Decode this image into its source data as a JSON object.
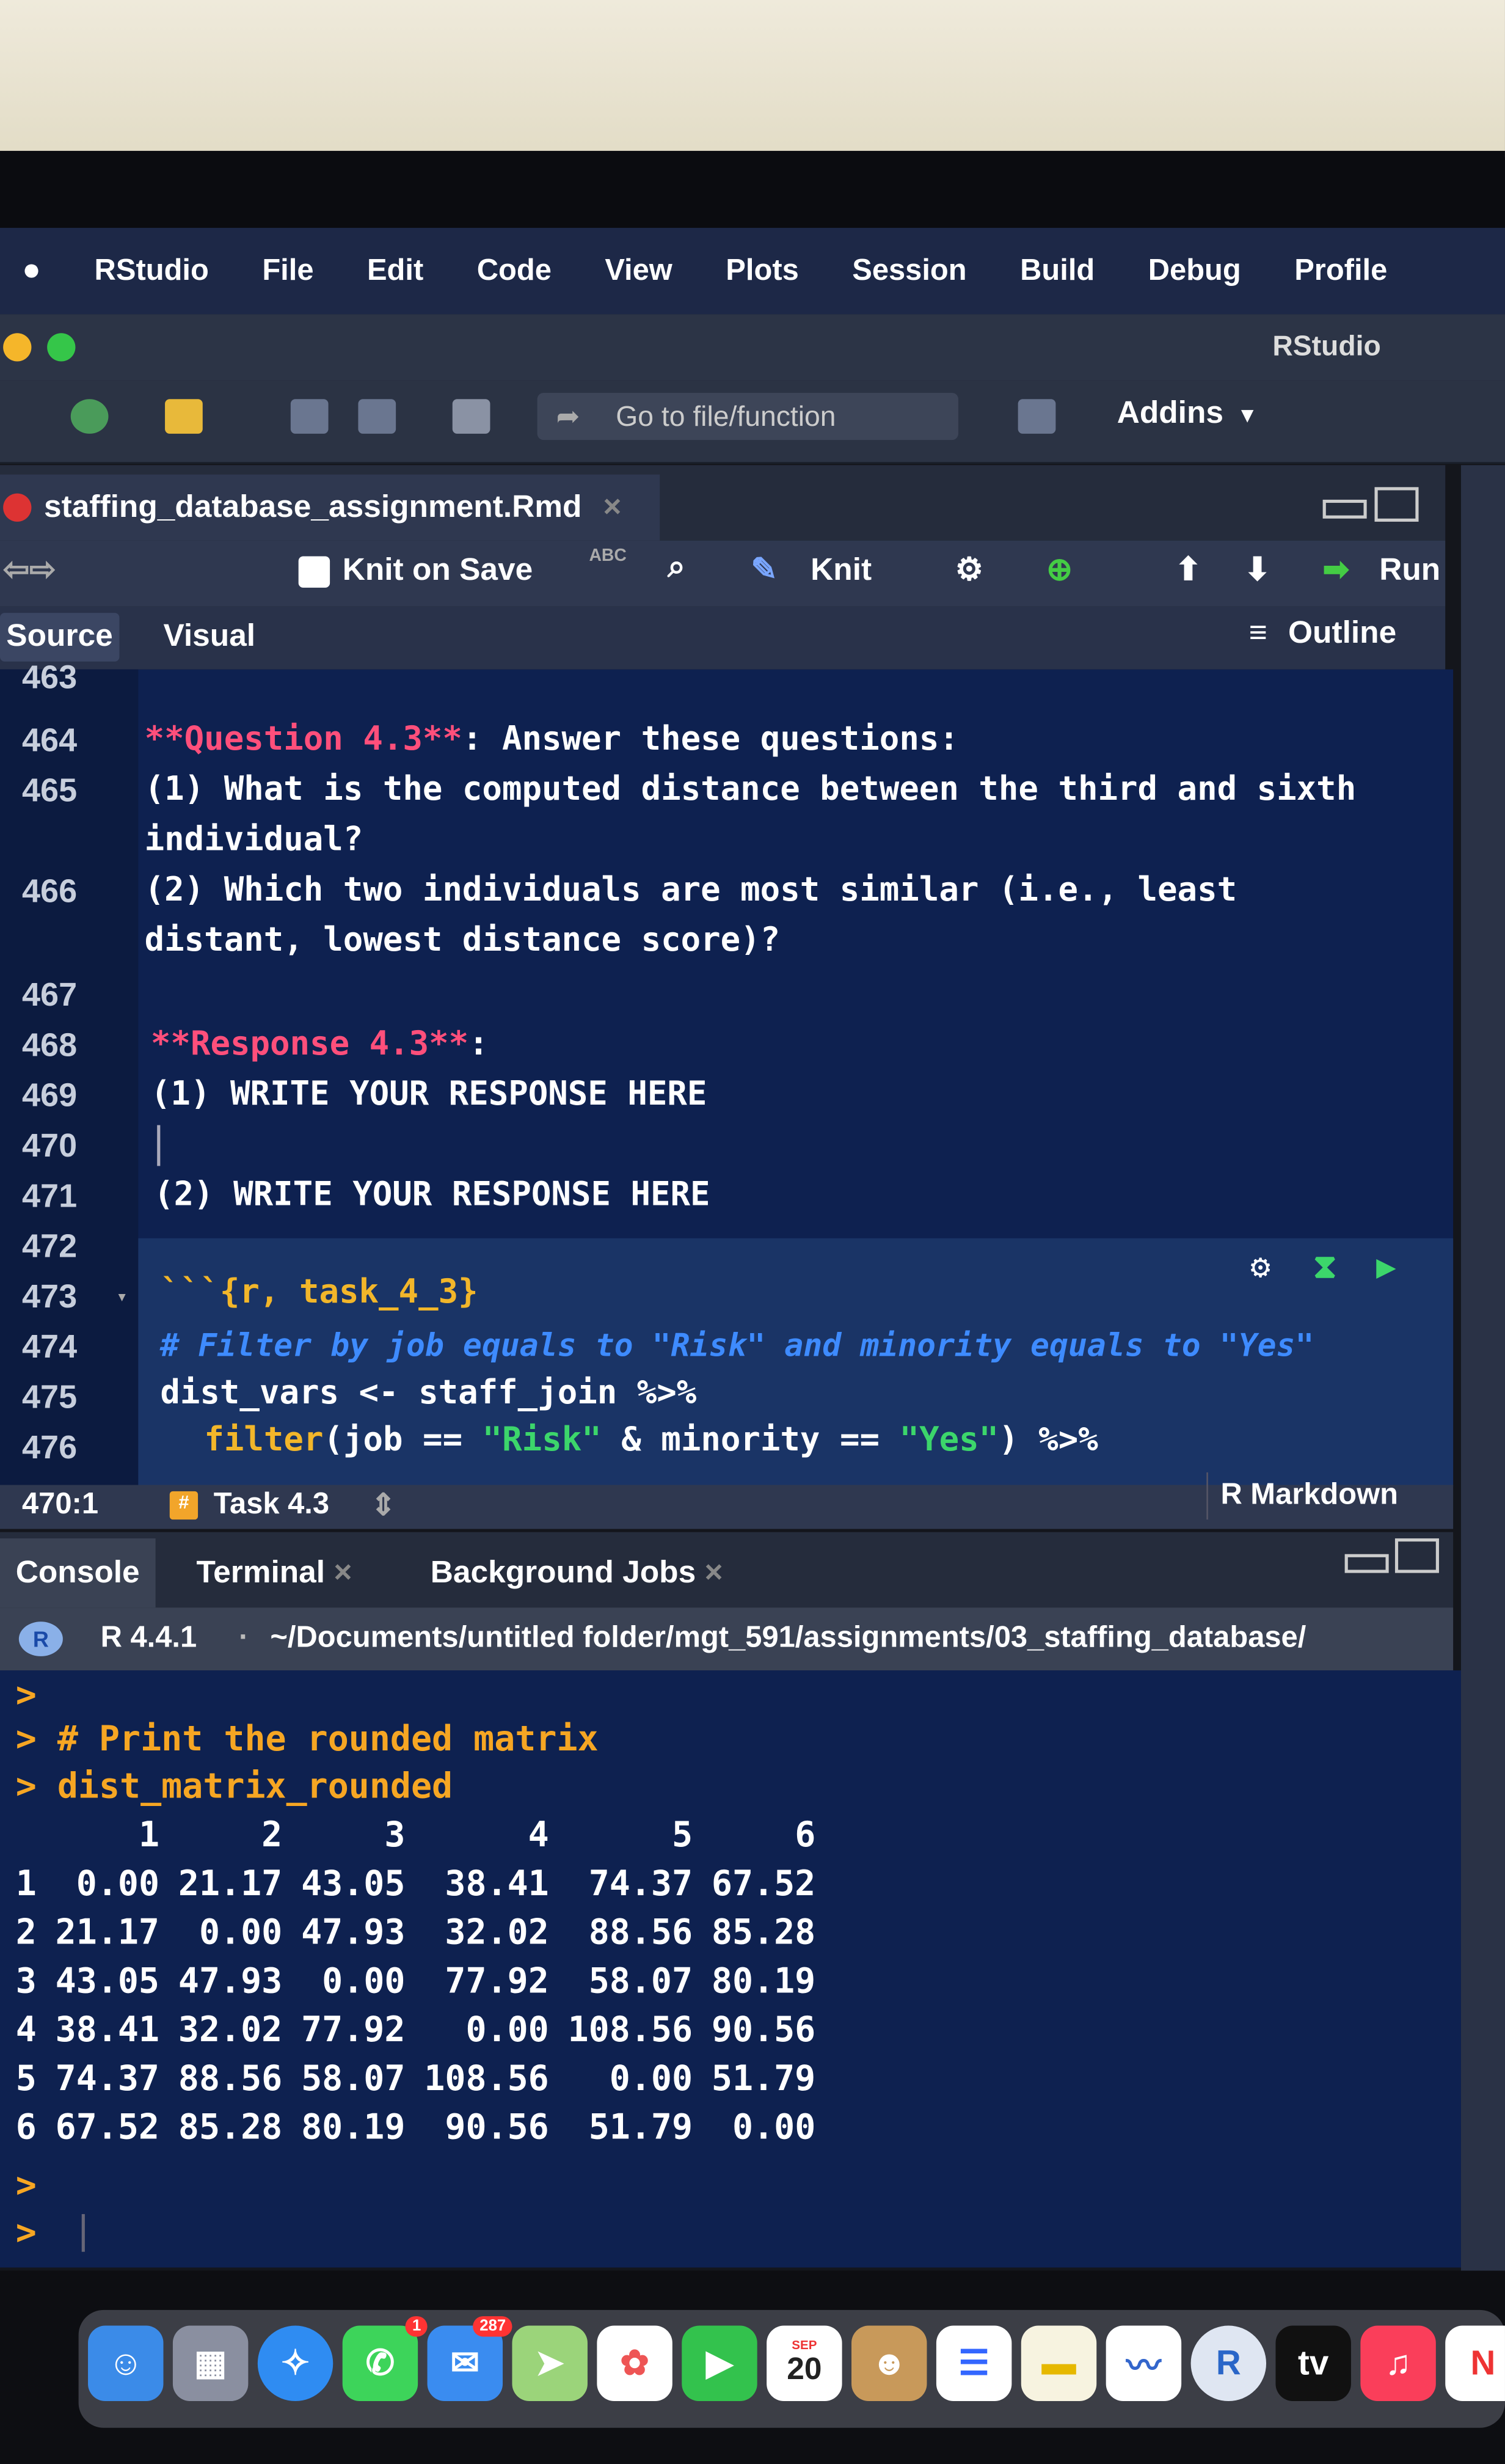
{
  "menubar": {
    "apple": "",
    "items": [
      "RStudio",
      "File",
      "Edit",
      "Code",
      "View",
      "Plots",
      "Session",
      "Build",
      "Debug",
      "Profile"
    ]
  },
  "window": {
    "title": "RStudio"
  },
  "toolbar": {
    "go_to_file": "Go to file/function",
    "addins": "Addins"
  },
  "editor": {
    "file_tab": "staffing_database_assignment.Rmd",
    "knit_on_save": "Knit on Save",
    "knit": "Knit",
    "run": "Run",
    "spell_icon": "ABC",
    "source_tab": "Source",
    "visual_tab": "Visual",
    "outline": "Outline",
    "lines": [
      {
        "n": "463"
      },
      {
        "n": "464",
        "a": "**Question 4.3**",
        "b": ": Answer these questions:"
      },
      {
        "n": "465",
        "text": "(1) What is the computed distance between the third and sixth",
        "cont": "individual?"
      },
      {
        "n": "466",
        "text": "(2) Which two individuals are most similar (i.e., least",
        "cont": "distant, lowest distance score)?"
      },
      {
        "n": "467"
      },
      {
        "n": "468",
        "a": "**Response 4.3**",
        "b": ":"
      },
      {
        "n": "469",
        "text": "(1) WRITE YOUR RESPONSE HERE"
      },
      {
        "n": "470"
      },
      {
        "n": "471",
        "text": "(2) WRITE YOUR RESPONSE HERE"
      },
      {
        "n": "472"
      },
      {
        "n": "473",
        "text": "```{r, task_4_3}"
      },
      {
        "n": "474",
        "text": "# Filter by job equals to \"Risk\" and minority equals to \"Yes\""
      },
      {
        "n": "475",
        "text": "dist_vars <- staff_join %>%"
      },
      {
        "n": "476",
        "f": "filter",
        "g": "(job == ",
        "s1": "\"Risk\"",
        "h": " & minority == ",
        "s2": "\"Yes\"",
        "i": ") %>%"
      }
    ],
    "status": {
      "position": "470:1",
      "section": "Task 4.3",
      "mode": "R Markdown"
    }
  },
  "console": {
    "tabs": [
      "Console",
      "Terminal",
      "Background Jobs"
    ],
    "r_version": "R 4.4.1",
    "path": "~/Documents/untitled folder/mgt_591/assignments/03_staffing_database/",
    "lines": [
      ">",
      "> # Print the rounded matrix",
      "> dist_matrix_rounded"
    ],
    "matrix": {
      "headers": [
        "",
        "1",
        "2",
        "3",
        "4",
        "5",
        "6"
      ],
      "rows": [
        [
          "1",
          "0.00",
          "21.17",
          "43.05",
          "38.41",
          "74.37",
          "67.52"
        ],
        [
          "2",
          "21.17",
          "0.00",
          "47.93",
          "32.02",
          "88.56",
          "85.28"
        ],
        [
          "3",
          "43.05",
          "47.93",
          "0.00",
          "77.92",
          "58.07",
          "80.19"
        ],
        [
          "4",
          "38.41",
          "32.02",
          "77.92",
          "0.00",
          "108.56",
          "90.56"
        ],
        [
          "5",
          "74.37",
          "88.56",
          "58.07",
          "108.56",
          "0.00",
          "51.79"
        ],
        [
          "6",
          "67.52",
          "85.28",
          "80.19",
          "90.56",
          "51.79",
          "0.00"
        ]
      ]
    },
    "prompts": [
      ">",
      ">"
    ]
  },
  "dock": {
    "messages_badge": "1",
    "mail_badge": "287",
    "calendar_month": "SEP",
    "calendar_day": "20",
    "tv": "tv",
    "r": "R"
  }
}
